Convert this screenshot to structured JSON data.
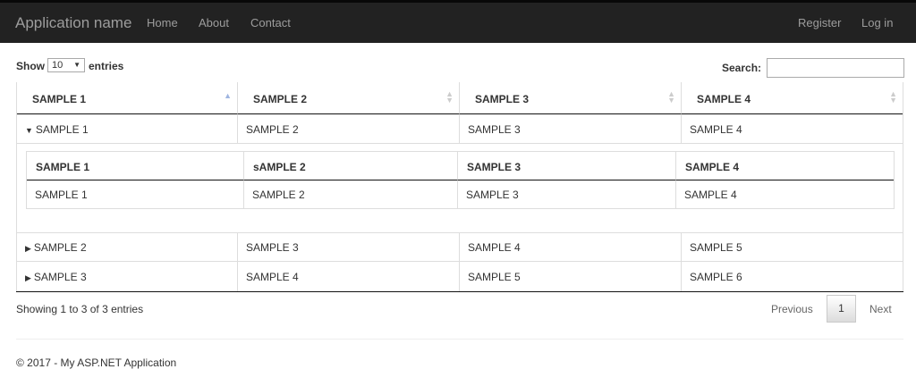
{
  "navbar": {
    "brand": "Application name",
    "links": [
      "Home",
      "About",
      "Contact"
    ],
    "right_links": [
      "Register",
      "Log in"
    ]
  },
  "controls": {
    "show_label": "Show",
    "page_size": "10",
    "entries_label": "entries",
    "search_label": "Search:",
    "search_value": ""
  },
  "table": {
    "headers": [
      "SAMPLE 1",
      "SAMPLE 2",
      "SAMPLE 3",
      "SAMPLE 4"
    ],
    "rows": [
      {
        "expanded": true,
        "cells": [
          "SAMPLE 1",
          "SAMPLE 2",
          "SAMPLE 3",
          "SAMPLE 4"
        ]
      },
      {
        "expanded": false,
        "cells": [
          "SAMPLE 2",
          "SAMPLE 3",
          "SAMPLE 4",
          "SAMPLE 5"
        ]
      },
      {
        "expanded": false,
        "cells": [
          "SAMPLE 3",
          "SAMPLE 4",
          "SAMPLE 5",
          "SAMPLE 6"
        ]
      }
    ],
    "child": {
      "headers": [
        "SAMPLE 1",
        "sAMPLE 2",
        "SAMPLE 3",
        "SAMPLE 4"
      ],
      "cells": [
        "SAMPLE 1",
        "SAMPLE 2",
        "SAMPLE 3",
        "SAMPLE 4"
      ]
    }
  },
  "pagination": {
    "info": "Showing 1 to 3 of 3 entries",
    "previous": "Previous",
    "current": "1",
    "next": "Next"
  },
  "footer": {
    "text": "© 2017 - My ASP.NET Application"
  },
  "icons": {
    "expanded": "triangle-down-icon",
    "collapsed": "triangle-right-icon",
    "sort_asc": "sort-asc-icon",
    "sort_both": "sort-both-icon"
  }
}
